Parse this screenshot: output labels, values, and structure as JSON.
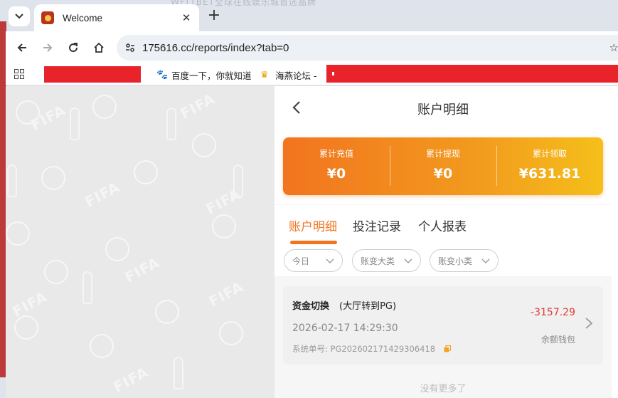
{
  "browser": {
    "tab_title": "Welcome",
    "url": "175616.cc/reports/index?tab=0",
    "bookmarks": [
      {
        "label": "百度一下，你就知道",
        "icon": "baidu-paw-icon"
      },
      {
        "label": "海燕论坛 -",
        "icon": "forum-icon"
      }
    ],
    "background_window_text": "WELTBET全球在线娱乐城首选品牌"
  },
  "app": {
    "title": "账户明细",
    "summary": [
      {
        "label": "累计充值",
        "value": "¥0"
      },
      {
        "label": "累计提现",
        "value": "¥0"
      },
      {
        "label": "累计领取",
        "value": "¥631.81"
      }
    ],
    "tabs": [
      {
        "label": "账户明细",
        "active": true
      },
      {
        "label": "投注记录",
        "active": false
      },
      {
        "label": "个人报表",
        "active": false
      }
    ],
    "filters": [
      "今日",
      "账变大类",
      "账变小类"
    ],
    "record": {
      "type": "资金切换",
      "detail": "(大厅转到PG)",
      "amount": "-3157.29",
      "time": "2026-02-17 14:29:30",
      "wallet": "余额钱包",
      "order_label": "系统单号:",
      "order_no": "PG202602171429306418"
    },
    "no_more": "没有更多了"
  },
  "colors": {
    "accent": "#f2741f",
    "gradient_end": "#f5bf1a",
    "negative": "#e23c34",
    "redaction": "#e8232a"
  }
}
